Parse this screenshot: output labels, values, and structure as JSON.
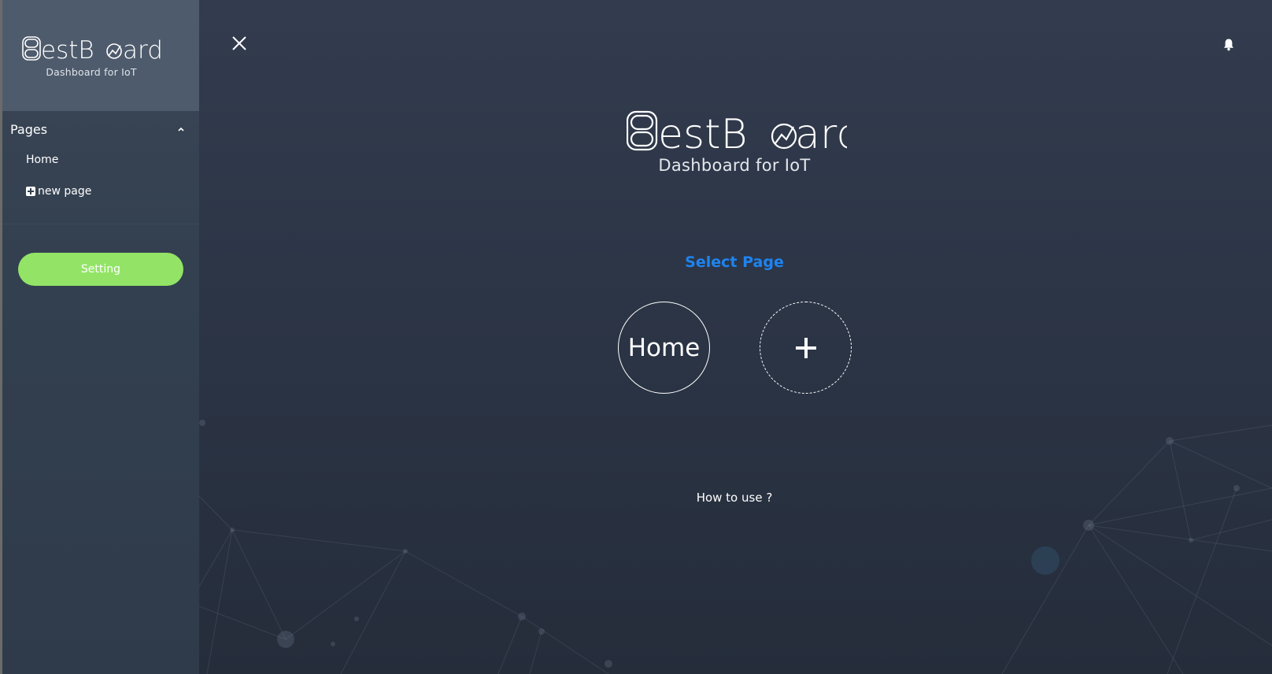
{
  "brand": {
    "name": "BestBoard",
    "name_rest": "estB",
    "name_end": "ard",
    "tagline": "Dashboard for IoT"
  },
  "sidebar": {
    "section_title": "Pages",
    "items": [
      {
        "label": "Home"
      },
      {
        "label": "new page"
      }
    ],
    "setting_label": "Setting"
  },
  "main": {
    "select_title": "Select Page",
    "pages": [
      {
        "label": "Home"
      }
    ],
    "add_icon": "plus-icon",
    "howto_label": "How to use ?"
  },
  "icons": {
    "close": "close-icon",
    "bell": "bell-icon",
    "collapse": "chevron-up-icon"
  },
  "colors": {
    "accent_green": "#93e466",
    "accent_blue": "#1e84f0",
    "sidebar_header": "#4e5b6c",
    "background": "#2b3445"
  }
}
